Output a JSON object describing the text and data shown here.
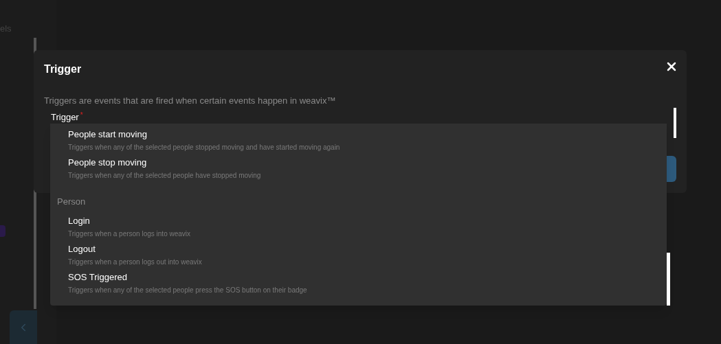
{
  "sidebar": {
    "heading": "els"
  },
  "modal": {
    "title": "Trigger",
    "description": "Triggers are events that are fired when certain events happen in weavix™",
    "field": {
      "label": "Trigger",
      "required": true,
      "required_mark": "*"
    }
  },
  "dropdown": {
    "items": [
      {
        "kind": "option",
        "title": "People start moving",
        "description": "Triggers when any of the selected people stopped moving and have started moving again"
      },
      {
        "kind": "option",
        "title": "People stop moving",
        "description": "Triggers when any of the selected people have stopped moving"
      },
      {
        "kind": "group",
        "label": "Person"
      },
      {
        "kind": "option",
        "title": "Login",
        "description": "Triggers when a person logs into weavix"
      },
      {
        "kind": "option",
        "title": "Logout",
        "description": "Triggers when a person logs out into weavix"
      },
      {
        "kind": "option",
        "title": "SOS Triggered",
        "description": "Triggers when any of the selected people press the SOS button on their badge"
      }
    ]
  }
}
